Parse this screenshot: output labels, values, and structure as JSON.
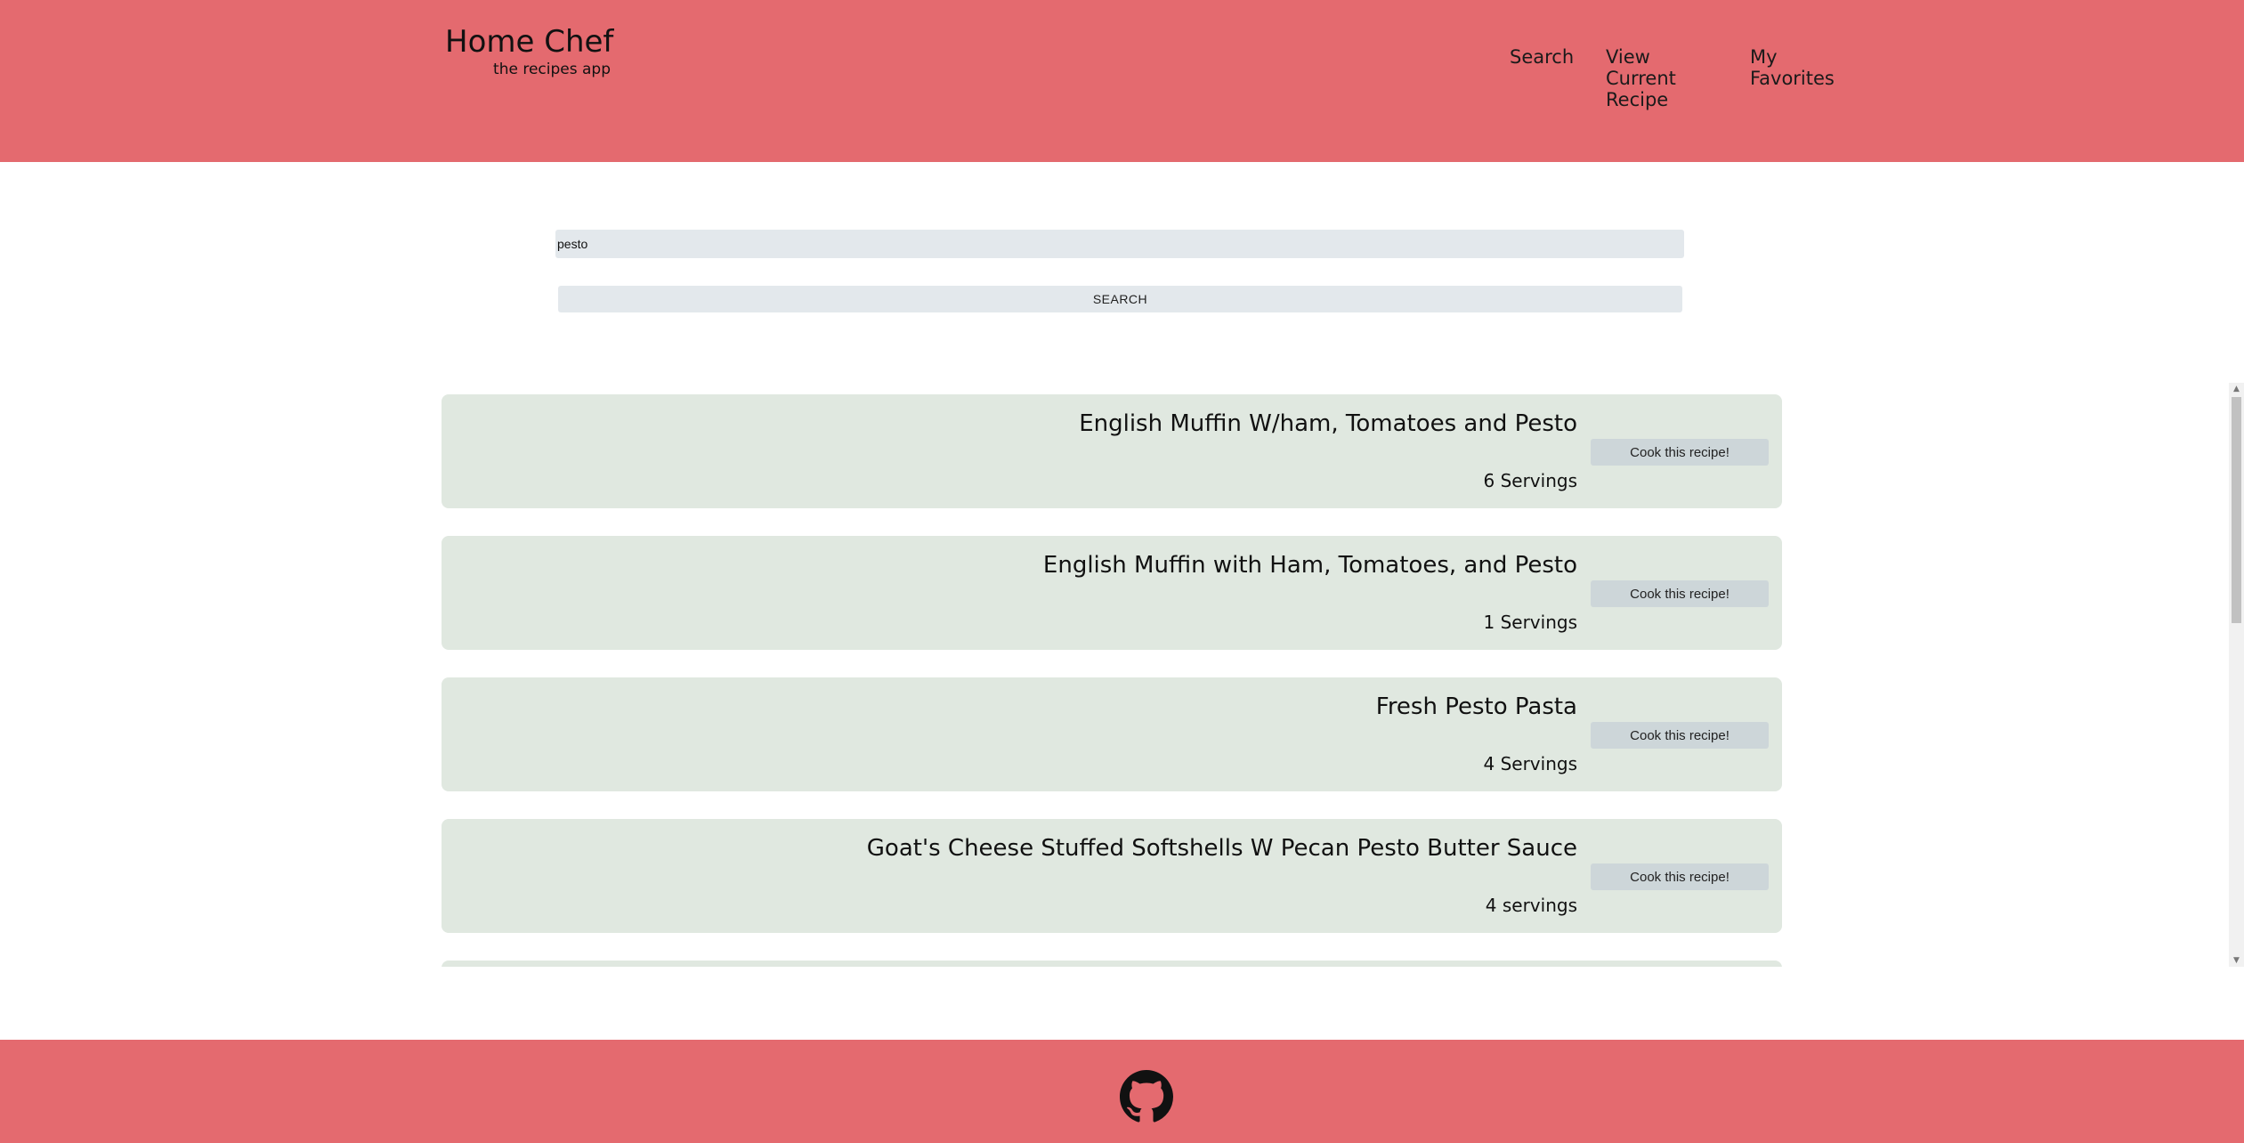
{
  "header": {
    "brand_title": "Home Chef",
    "brand_subtitle": "the recipes app",
    "nav": {
      "search": "Search",
      "current_recipe": "View Current Recipe",
      "favorites": "My Favorites"
    }
  },
  "search": {
    "value": "pesto",
    "button_label": "SEARCH"
  },
  "results": [
    {
      "title": "English Muffin W/ham, Tomatoes and Pesto",
      "servings": "6 Servings",
      "button": "Cook this recipe!"
    },
    {
      "title": "English Muffin with Ham, Tomatoes, and Pesto",
      "servings": "1 Servings",
      "button": "Cook this recipe!"
    },
    {
      "title": "Fresh Pesto Pasta",
      "servings": "4 Servings",
      "button": "Cook this recipe!"
    },
    {
      "title": "Goat's Cheese Stuffed Softshells W Pecan Pesto Butter Sauce",
      "servings": "4 servings",
      "button": "Cook this recipe!"
    }
  ],
  "footer": {
    "icon": "github-icon"
  },
  "colors": {
    "header_bg": "#e46a6f",
    "card_bg": "#e0e8e0",
    "input_bg": "#e3e8ec",
    "button_bg": "#cdd6d9"
  }
}
